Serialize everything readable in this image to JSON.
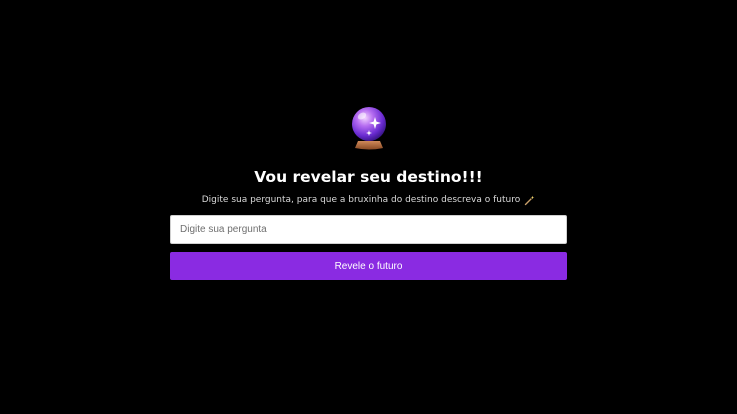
{
  "header": {
    "orb_icon": "crystal-ball-icon",
    "title": "Vou revelar seu destino!!!",
    "subtitle": "Digite sua pergunta, para que a bruxinha do destino descreva o futuro",
    "subtitle_icon": "magic-wand-icon"
  },
  "form": {
    "question": {
      "value": "",
      "placeholder": "Digite sua pergunta"
    },
    "submit_label": "Revele o futuro"
  },
  "colors": {
    "background": "#000000",
    "accent": "#8a2be2",
    "title": "#ffffff"
  }
}
